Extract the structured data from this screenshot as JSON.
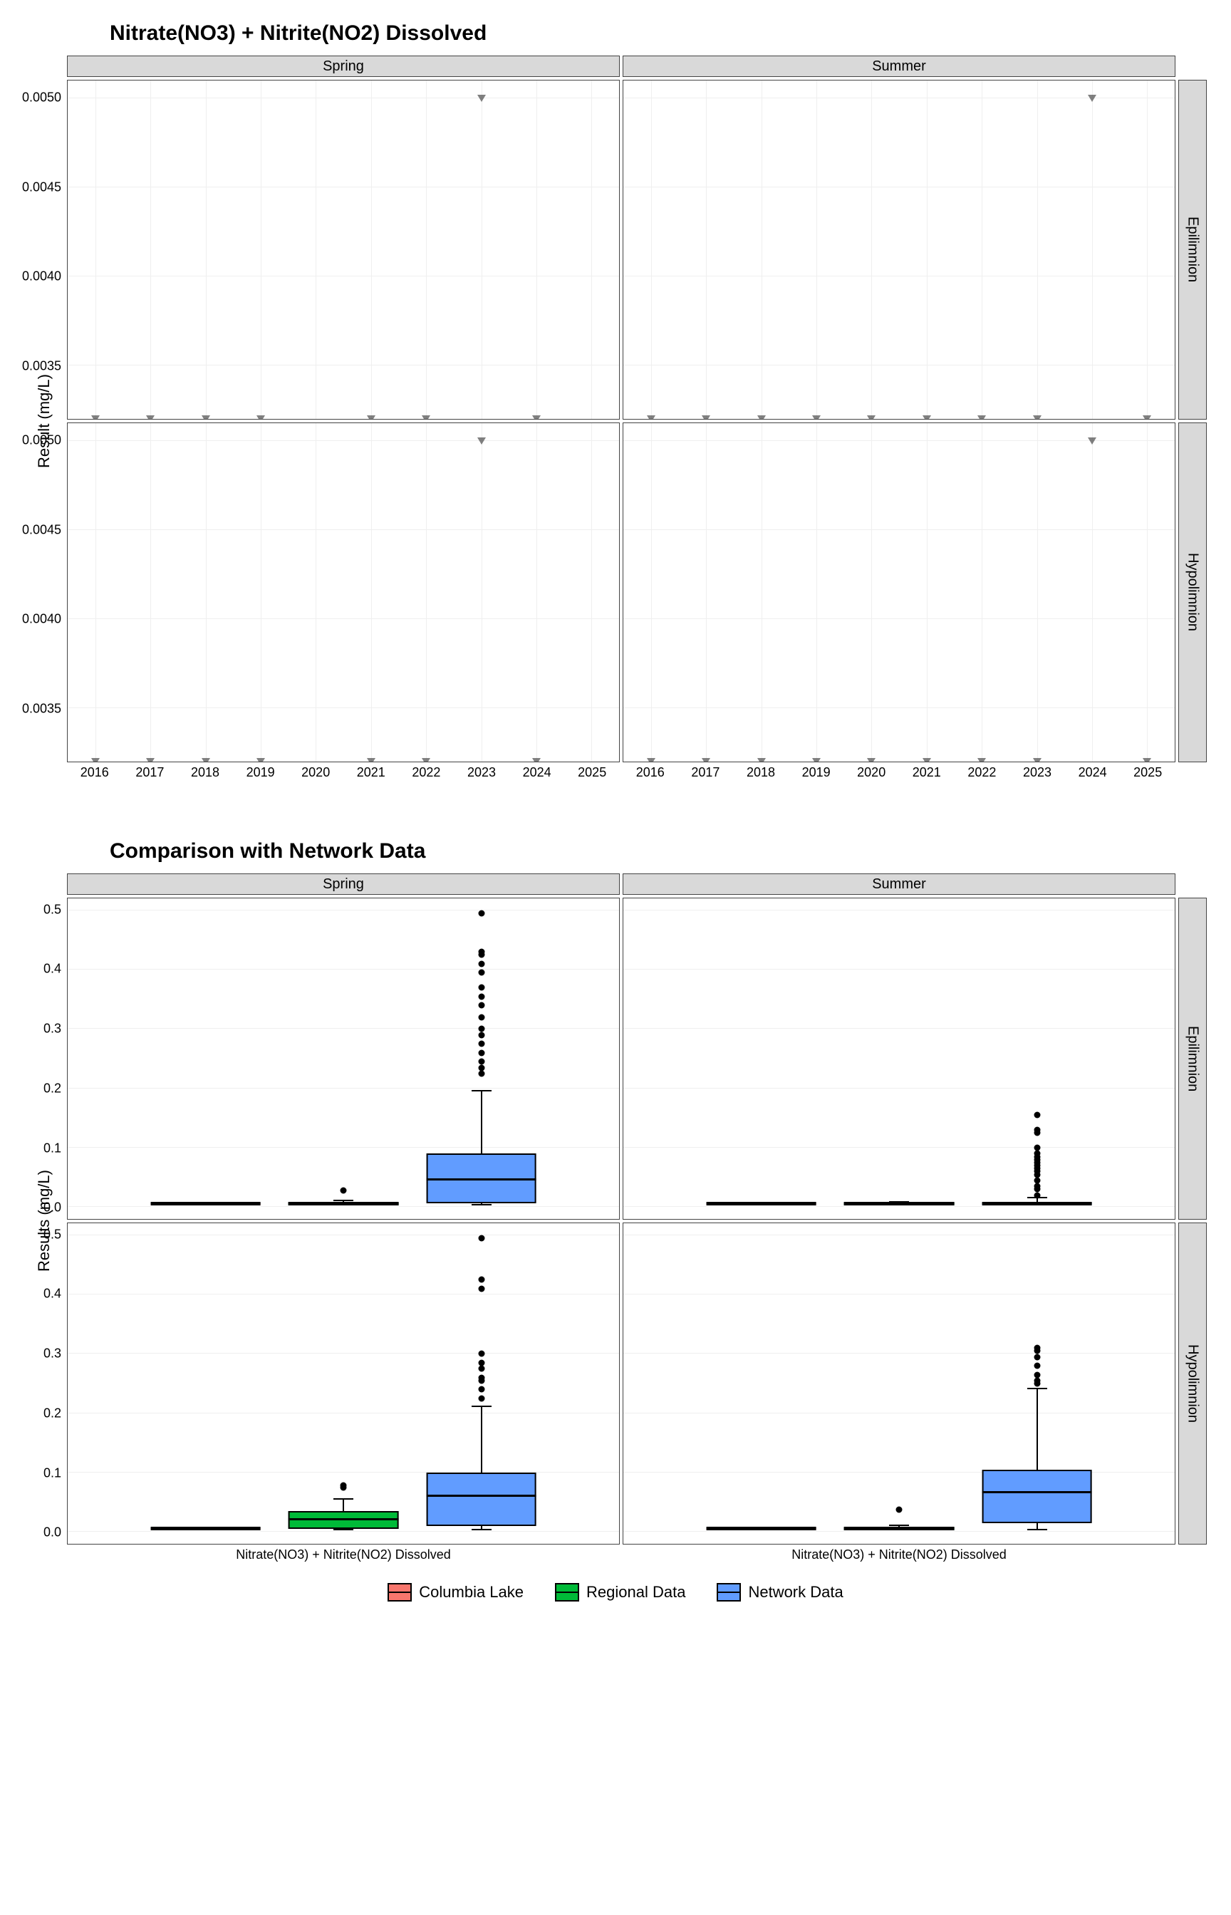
{
  "chart_data": [
    {
      "type": "scatter",
      "title": "Nitrate(NO3) + Nitrite(NO2) Dissolved",
      "ylabel": "Result (mg/L)",
      "xlabel": "",
      "x_ticks": [
        2016,
        2017,
        2018,
        2019,
        2020,
        2021,
        2022,
        2023,
        2024,
        2025
      ],
      "y_ticks": [
        0.0035,
        0.004,
        0.0045,
        0.005
      ],
      "ylim": [
        0.0032,
        0.0051
      ],
      "xlim": [
        2015.5,
        2025.5
      ],
      "col_facets": [
        "Spring",
        "Summer"
      ],
      "row_facets": [
        "Epilimnion",
        "Hypolimnion"
      ],
      "panels": {
        "Spring|Epilimnion": [
          {
            "x": 2016,
            "y": 0.0032
          },
          {
            "x": 2017,
            "y": 0.0032
          },
          {
            "x": 2018,
            "y": 0.0032
          },
          {
            "x": 2019,
            "y": 0.0032
          },
          {
            "x": 2021,
            "y": 0.0032
          },
          {
            "x": 2022,
            "y": 0.0032
          },
          {
            "x": 2023,
            "y": 0.005
          },
          {
            "x": 2024,
            "y": 0.0032
          }
        ],
        "Summer|Epilimnion": [
          {
            "x": 2016,
            "y": 0.0032
          },
          {
            "x": 2017,
            "y": 0.0032
          },
          {
            "x": 2018,
            "y": 0.0032
          },
          {
            "x": 2019,
            "y": 0.0032
          },
          {
            "x": 2020,
            "y": 0.0032
          },
          {
            "x": 2021,
            "y": 0.0032
          },
          {
            "x": 2022,
            "y": 0.0032
          },
          {
            "x": 2023,
            "y": 0.0032
          },
          {
            "x": 2024,
            "y": 0.005
          },
          {
            "x": 2025,
            "y": 0.0032
          }
        ],
        "Spring|Hypolimnion": [
          {
            "x": 2016,
            "y": 0.0032
          },
          {
            "x": 2017,
            "y": 0.0032
          },
          {
            "x": 2018,
            "y": 0.0032
          },
          {
            "x": 2019,
            "y": 0.0032
          },
          {
            "x": 2021,
            "y": 0.0032
          },
          {
            "x": 2022,
            "y": 0.0032
          },
          {
            "x": 2023,
            "y": 0.005
          },
          {
            "x": 2024,
            "y": 0.0032
          }
        ],
        "Summer|Hypolimnion": [
          {
            "x": 2016,
            "y": 0.0032
          },
          {
            "x": 2017,
            "y": 0.0032
          },
          {
            "x": 2018,
            "y": 0.0032
          },
          {
            "x": 2019,
            "y": 0.0032
          },
          {
            "x": 2020,
            "y": 0.0032
          },
          {
            "x": 2021,
            "y": 0.0032
          },
          {
            "x": 2022,
            "y": 0.0032
          },
          {
            "x": 2023,
            "y": 0.0032
          },
          {
            "x": 2024,
            "y": 0.005
          },
          {
            "x": 2025,
            "y": 0.0032
          }
        ]
      }
    },
    {
      "type": "boxplot",
      "title": "Comparison with Network Data",
      "ylabel": "Results (mg/L)",
      "xlabel": "",
      "x_tick_label": "Nitrate(NO3) + Nitrite(NO2) Dissolved",
      "y_ticks": [
        0.0,
        0.1,
        0.2,
        0.3,
        0.4,
        0.5
      ],
      "ylim": [
        -0.02,
        0.52
      ],
      "col_facets": [
        "Spring",
        "Summer"
      ],
      "row_facets": [
        "Epilimnion",
        "Hypolimnion"
      ],
      "series": [
        "Columbia Lake",
        "Regional Data",
        "Network Data"
      ],
      "series_colors": {
        "Columbia Lake": "#f8766d",
        "Regional Data": "#00ba38",
        "Network Data": "#619cff"
      },
      "panels": {
        "Spring|Epilimnion": {
          "Columbia Lake": {
            "min": 0.003,
            "q1": 0.003,
            "med": 0.003,
            "q3": 0.005,
            "max": 0.005,
            "out": []
          },
          "Regional Data": {
            "min": 0.003,
            "q1": 0.003,
            "med": 0.004,
            "q3": 0.006,
            "max": 0.01,
            "out": [
              0.028
            ]
          },
          "Network Data": {
            "min": 0.003,
            "q1": 0.006,
            "med": 0.045,
            "q3": 0.09,
            "max": 0.195,
            "out": [
              0.225,
              0.235,
              0.245,
              0.26,
              0.275,
              0.29,
              0.3,
              0.32,
              0.34,
              0.355,
              0.37,
              0.395,
              0.41,
              0.425,
              0.43,
              0.495
            ]
          }
        },
        "Summer|Epilimnion": {
          "Columbia Lake": {
            "min": 0.003,
            "q1": 0.003,
            "med": 0.003,
            "q3": 0.005,
            "max": 0.005,
            "out": []
          },
          "Regional Data": {
            "min": 0.003,
            "q1": 0.003,
            "med": 0.004,
            "q3": 0.005,
            "max": 0.008,
            "out": []
          },
          "Network Data": {
            "min": 0.003,
            "q1": 0.003,
            "med": 0.004,
            "q3": 0.008,
            "max": 0.015,
            "out": [
              0.02,
              0.03,
              0.035,
              0.045,
              0.055,
              0.06,
              0.065,
              0.07,
              0.075,
              0.08,
              0.085,
              0.09,
              0.1,
              0.125,
              0.13,
              0.155
            ]
          }
        },
        "Spring|Hypolimnion": {
          "Columbia Lake": {
            "min": 0.003,
            "q1": 0.003,
            "med": 0.003,
            "q3": 0.005,
            "max": 0.005,
            "out": []
          },
          "Regional Data": {
            "min": 0.003,
            "q1": 0.005,
            "med": 0.02,
            "q3": 0.035,
            "max": 0.055,
            "out": [
              0.075,
              0.078
            ]
          },
          "Network Data": {
            "min": 0.003,
            "q1": 0.01,
            "med": 0.06,
            "q3": 0.1,
            "max": 0.21,
            "out": [
              0.225,
              0.24,
              0.255,
              0.26,
              0.275,
              0.285,
              0.3,
              0.41,
              0.425,
              0.495
            ]
          }
        },
        "Summer|Hypolimnion": {
          "Columbia Lake": {
            "min": 0.003,
            "q1": 0.003,
            "med": 0.003,
            "q3": 0.005,
            "max": 0.005,
            "out": []
          },
          "Regional Data": {
            "min": 0.003,
            "q1": 0.003,
            "med": 0.004,
            "q3": 0.006,
            "max": 0.01,
            "out": [
              0.038
            ]
          },
          "Network Data": {
            "min": 0.003,
            "q1": 0.015,
            "med": 0.065,
            "q3": 0.105,
            "max": 0.24,
            "out": [
              0.25,
              0.255,
              0.265,
              0.28,
              0.295,
              0.305,
              0.31
            ]
          }
        }
      }
    }
  ],
  "legend": {
    "items": [
      {
        "label": "Columbia Lake",
        "color": "red"
      },
      {
        "label": "Regional Data",
        "color": "green"
      },
      {
        "label": "Network Data",
        "color": "blue"
      }
    ]
  }
}
